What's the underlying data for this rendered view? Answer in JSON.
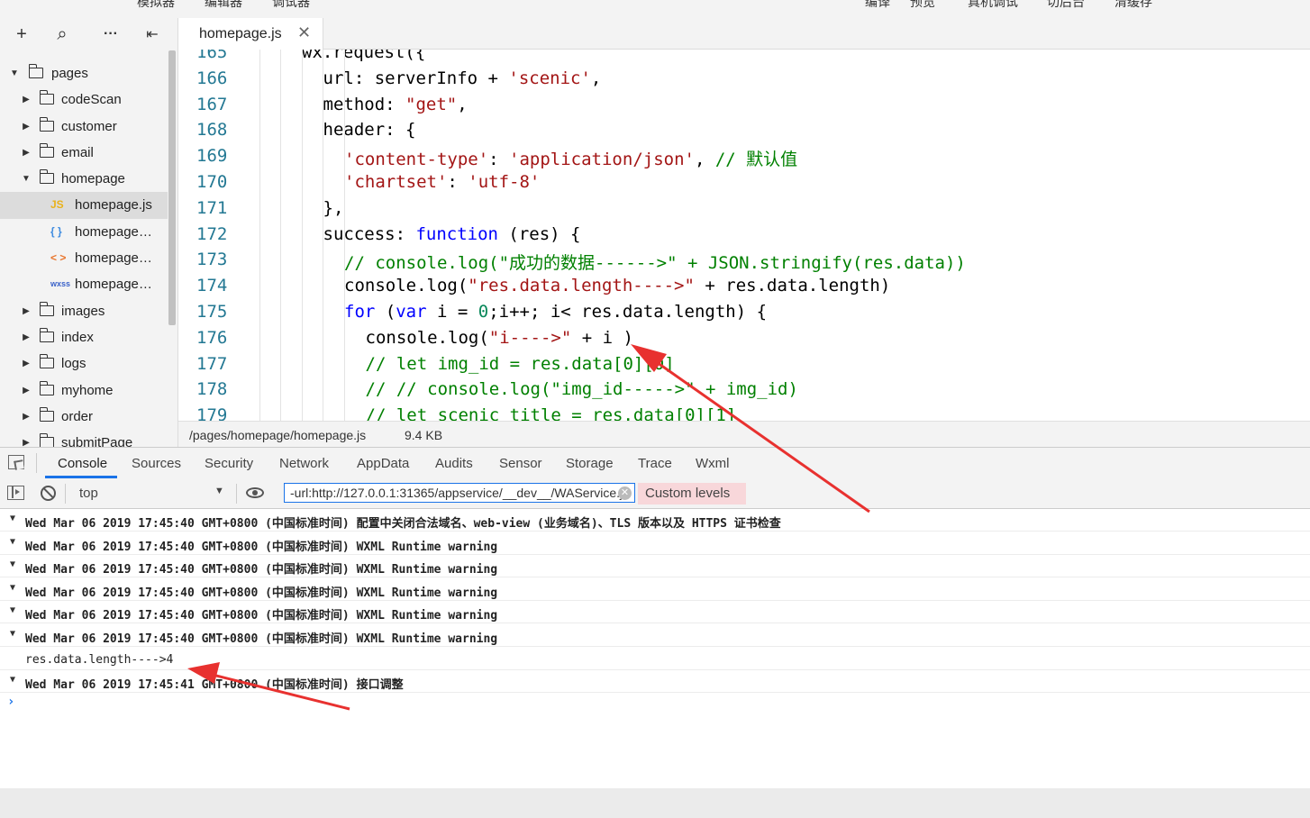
{
  "top_menu": [
    "模拟器",
    "编辑器",
    "调试器",
    "编译",
    "预览",
    "真机调试",
    "切后台",
    "清缓存"
  ],
  "sidebar": {
    "toolbar": {
      "add": "+",
      "search": "⌕",
      "more": "···",
      "collapse": "⇤"
    },
    "tree": [
      {
        "label": "pages",
        "type": "folder",
        "open": true,
        "level": 0
      },
      {
        "label": "codeScan",
        "type": "folder",
        "open": false,
        "level": 1
      },
      {
        "label": "customer",
        "type": "folder",
        "open": false,
        "level": 1
      },
      {
        "label": "email",
        "type": "folder",
        "open": false,
        "level": 1
      },
      {
        "label": "homepage",
        "type": "folder",
        "open": true,
        "level": 1
      },
      {
        "label": "homepage.js",
        "type": "js",
        "badge": "JS",
        "level": 2,
        "selected": true
      },
      {
        "label": "homepage…",
        "type": "json",
        "badge": "{ }",
        "level": 2
      },
      {
        "label": "homepage…",
        "type": "wxml",
        "badge": "< >",
        "level": 2
      },
      {
        "label": "homepage…",
        "type": "wxss",
        "badge": "wxss",
        "level": 2
      },
      {
        "label": "images",
        "type": "folder",
        "open": false,
        "level": 1
      },
      {
        "label": "index",
        "type": "folder",
        "open": false,
        "level": 1
      },
      {
        "label": "logs",
        "type": "folder",
        "open": false,
        "level": 1
      },
      {
        "label": "myhome",
        "type": "folder",
        "open": false,
        "level": 1
      },
      {
        "label": "order",
        "type": "folder",
        "open": false,
        "level": 1
      },
      {
        "label": "submitPage",
        "type": "folder",
        "open": false,
        "level": 1
      }
    ]
  },
  "editor": {
    "tab": {
      "label": "homepage.js",
      "close": "✕"
    },
    "lines": [
      {
        "n": "165",
        "indent": 1,
        "html": "wx.request({"
      },
      {
        "n": "166",
        "indent": 2,
        "html": "url: serverInfo + <span class=\"s\">'scenic'</span>,"
      },
      {
        "n": "167",
        "indent": 2,
        "html": "method: <span class=\"s\">\"get\"</span>,"
      },
      {
        "n": "168",
        "indent": 2,
        "html": "header: {"
      },
      {
        "n": "169",
        "indent": 3,
        "html": "<span class=\"s\">'content-type'</span>: <span class=\"s\">'application/json'</span>, <span class=\"c\">// 默认值</span>"
      },
      {
        "n": "170",
        "indent": 3,
        "html": "<span class=\"s\">'chartset'</span>: <span class=\"s\">'utf-8'</span>"
      },
      {
        "n": "171",
        "indent": 2,
        "html": "},"
      },
      {
        "n": "172",
        "indent": 2,
        "html": "success: <span class=\"k\">function</span> (res) {"
      },
      {
        "n": "173",
        "indent": 3,
        "html": "<span class=\"c\">// console.log(\"成功的数据------>\" + JSON.stringify(res.data))</span>"
      },
      {
        "n": "174",
        "indent": 3,
        "html": "console.log(<span class=\"s\">\"res.data.length---->\"</span> + res.data.length)"
      },
      {
        "n": "175",
        "indent": 3,
        "html": "<span class=\"k\">for</span> (<span class=\"k\">var</span> i = <span class=\"n\">0</span>;i++; i&lt; res.data.length) {"
      },
      {
        "n": "176",
        "indent": 4,
        "html": "console.log(<span class=\"s\">\"i---->\"</span> + i )"
      },
      {
        "n": "177",
        "indent": 4,
        "html": "<span class=\"c\">// let img_id = res.data[0][0]</span>"
      },
      {
        "n": "178",
        "indent": 4,
        "html": "<span class=\"c\">// // console.log(\"img_id----->\" + img_id)</span>"
      },
      {
        "n": "179",
        "indent": 4,
        "html": "<span class=\"c\">// let scenic title = res.data[0][1]</span>"
      }
    ]
  },
  "statusbar": {
    "path": "/pages/homepage/homepage.js",
    "size": "9.4 KB"
  },
  "devtools": {
    "tabs": [
      "Console",
      "Sources",
      "Security",
      "Network",
      "AppData",
      "Audits",
      "Sensor",
      "Storage",
      "Trace",
      "Wxml"
    ],
    "active_tab": "Console",
    "context": "top",
    "filter_value": "-url:http://127.0.0.1:31365/appservice/__dev__/WAService.js",
    "levels": "Custom levels"
  },
  "console": {
    "rows": [
      {
        "kind": "group",
        "text": "Wed Mar 06 2019 17:45:40 GMT+0800 (中国标准时间) 配置中关闭合法域名、web-view (业务域名)、TLS 版本以及 HTTPS 证书检查"
      },
      {
        "kind": "group",
        "text": "Wed Mar 06 2019 17:45:40 GMT+0800 (中国标准时间) WXML Runtime warning"
      },
      {
        "kind": "group",
        "text": "Wed Mar 06 2019 17:45:40 GMT+0800 (中国标准时间) WXML Runtime warning"
      },
      {
        "kind": "group",
        "text": "Wed Mar 06 2019 17:45:40 GMT+0800 (中国标准时间) WXML Runtime warning"
      },
      {
        "kind": "group",
        "text": "Wed Mar 06 2019 17:45:40 GMT+0800 (中国标准时间) WXML Runtime warning"
      },
      {
        "kind": "group",
        "text": "Wed Mar 06 2019 17:45:40 GMT+0800 (中国标准时间) WXML Runtime warning"
      },
      {
        "kind": "log",
        "text": "res.data.length---->4"
      },
      {
        "kind": "group",
        "text": "Wed Mar 06 2019 17:45:41 GMT+0800 (中国标准时间) 接口调整"
      }
    ],
    "prompt": "›"
  },
  "colors": {
    "annotation_arrow": "#e8312f",
    "line_number": "#237893",
    "accent": "#1a73e8"
  }
}
